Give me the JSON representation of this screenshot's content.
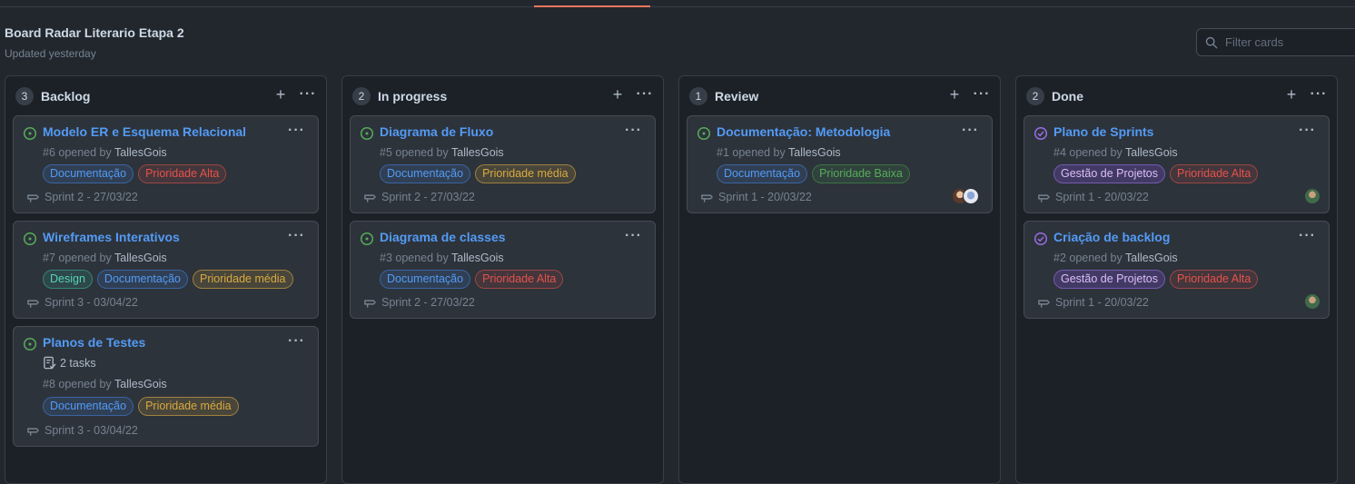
{
  "board": {
    "title": "Board Radar Literario Etapa 2",
    "updated": "Updated yesterday",
    "filter_placeholder": "Filter cards"
  },
  "colors": {
    "open_icon": "#57ab5a",
    "closed_icon": "#986ee2",
    "link": "#539bf5",
    "active_tab": "#ec775c"
  },
  "columns": [
    {
      "count": "3",
      "name": "Backlog",
      "cards": [
        {
          "status": "open",
          "title": "Modelo ER e Esquema Relacional",
          "meta": "#6 opened by",
          "author": "TallesGois",
          "labels": [
            "Documentação",
            "Prioridade Alta"
          ],
          "sprint": "Sprint 2 - 27/03/22"
        },
        {
          "status": "open",
          "title": "Wireframes Interativos",
          "meta": "#7 opened by",
          "author": "TallesGois",
          "labels": [
            "Design",
            "Documentação",
            "Prioridade média"
          ],
          "sprint": "Sprint 3 - 03/04/22"
        },
        {
          "status": "open",
          "title": "Planos de Testes",
          "tasks": "2 tasks",
          "meta": "#8 opened by",
          "author": "TallesGois",
          "labels": [
            "Documentação",
            "Prioridade média"
          ],
          "sprint": "Sprint 3 - 03/04/22"
        }
      ]
    },
    {
      "count": "2",
      "name": "In progress",
      "cards": [
        {
          "status": "open",
          "title": "Diagrama de Fluxo",
          "meta": "#5 opened by",
          "author": "TallesGois",
          "labels": [
            "Documentação",
            "Prioridade média"
          ],
          "sprint": "Sprint 2 - 27/03/22"
        },
        {
          "status": "open",
          "title": "Diagrama de classes",
          "meta": "#3 opened by",
          "author": "TallesGois",
          "labels": [
            "Documentação",
            "Prioridade Alta"
          ],
          "sprint": "Sprint 2 - 27/03/22"
        }
      ]
    },
    {
      "count": "1",
      "name": "Review",
      "cards": [
        {
          "status": "open",
          "title": "Documentação: Metodologia",
          "meta": "#1 opened by",
          "author": "TallesGois",
          "labels": [
            "Documentação",
            "Prioridade Baixa"
          ],
          "sprint": "Sprint 1 - 20/03/22"
        }
      ]
    },
    {
      "count": "2",
      "name": "Done",
      "cards": [
        {
          "status": "closed",
          "title": "Plano de Sprints",
          "meta": "#4 opened by",
          "author": "TallesGois",
          "labels": [
            "Gestão de Projetos",
            "Prioridade Alta"
          ],
          "sprint": "Sprint 1 - 20/03/22"
        },
        {
          "status": "closed",
          "title": "Criação de backlog",
          "meta": "#2 opened by",
          "author": "TallesGois",
          "labels": [
            "Gestão de Projetos",
            "Prioridade Alta"
          ],
          "sprint": "Sprint 1 - 20/03/22"
        }
      ]
    }
  ]
}
